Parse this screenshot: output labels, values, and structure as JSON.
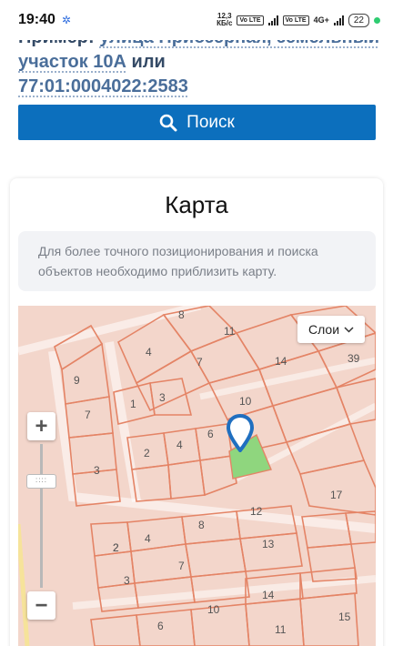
{
  "status_bar": {
    "time": "19:40",
    "net_speed_value": "12,3",
    "net_speed_unit": "КБ/с",
    "sim1_chip": "Vo LTE",
    "sim2_chip": "Vo LTE",
    "network": "4G+",
    "battery": "22"
  },
  "search": {
    "example_prefix": "Пример:",
    "example_address": "улица Приозерная, земельный участок 10А",
    "example_or": "или",
    "example_cadastral": "77:01:0004022:2583",
    "button_label": "Поиск"
  },
  "map_section": {
    "title": "Карта",
    "hint": "Для более точного позиционирования и поиска объектов необходимо приблизить карту.",
    "layers_label": "Слои",
    "zoom_in": "+",
    "zoom_out": "−",
    "parcel_numbers": [
      "8",
      "11",
      "4",
      "7",
      "14",
      "39",
      "9",
      "1",
      "3",
      "10",
      "7",
      "6",
      "2",
      "4",
      "3",
      "17",
      "2",
      "12",
      "8",
      "2",
      "4",
      "13",
      "3",
      "7",
      "14",
      "10",
      "6",
      "11",
      "15"
    ]
  },
  "colors": {
    "primary_button": "#0c6fbd",
    "parcel_fill": "#f3d6cb",
    "parcel_border": "#e07b5f",
    "selected_parcel": "#8fd67e",
    "marker": "#1f6fc0"
  }
}
